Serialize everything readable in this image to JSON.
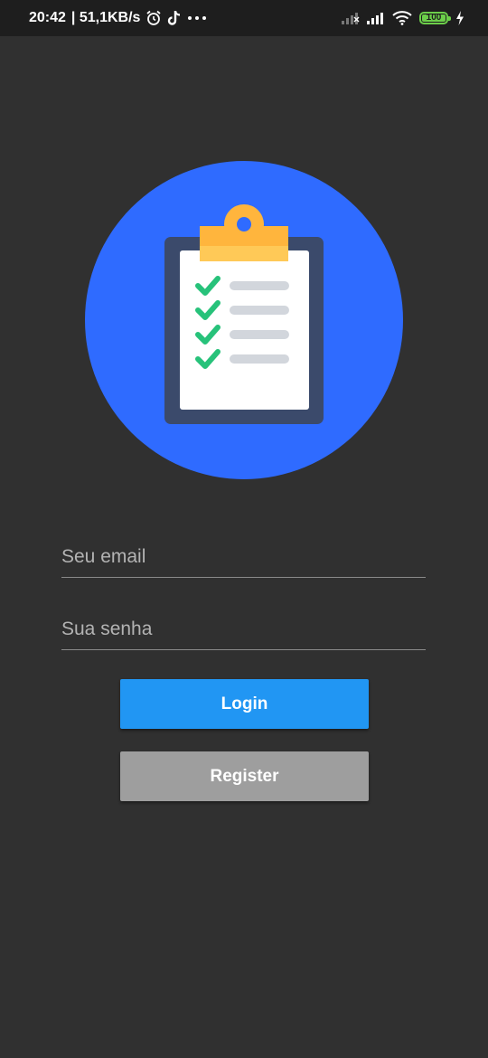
{
  "status_bar": {
    "time": "20:42",
    "network_speed": "| 51,1KB/s",
    "battery_level": "100",
    "battery_percent": 100,
    "icons": [
      "alarm-icon",
      "tiktok-icon",
      "more-dots-icon",
      "signal-empty-icon",
      "signal-icon",
      "wifi-icon",
      "battery-icon",
      "charging-icon"
    ]
  },
  "hero": {
    "icon": "clipboard-checklist-icon",
    "colors": {
      "circle": "#2f6bff",
      "board": "#3b4a6b",
      "clip": "#ffb53d",
      "paper": "#ffffff",
      "check": "#27c27a",
      "line": "#d2d6dc"
    },
    "checklist_items": 4
  },
  "form": {
    "email_placeholder": "Seu email",
    "email_value": "",
    "password_placeholder": "Sua senha",
    "password_value": "",
    "login_label": "Login",
    "register_label": "Register"
  },
  "colors": {
    "background": "#303030",
    "status_bar": "#1e1e1e",
    "login_button": "#2196f3",
    "register_button": "#9e9e9e"
  }
}
